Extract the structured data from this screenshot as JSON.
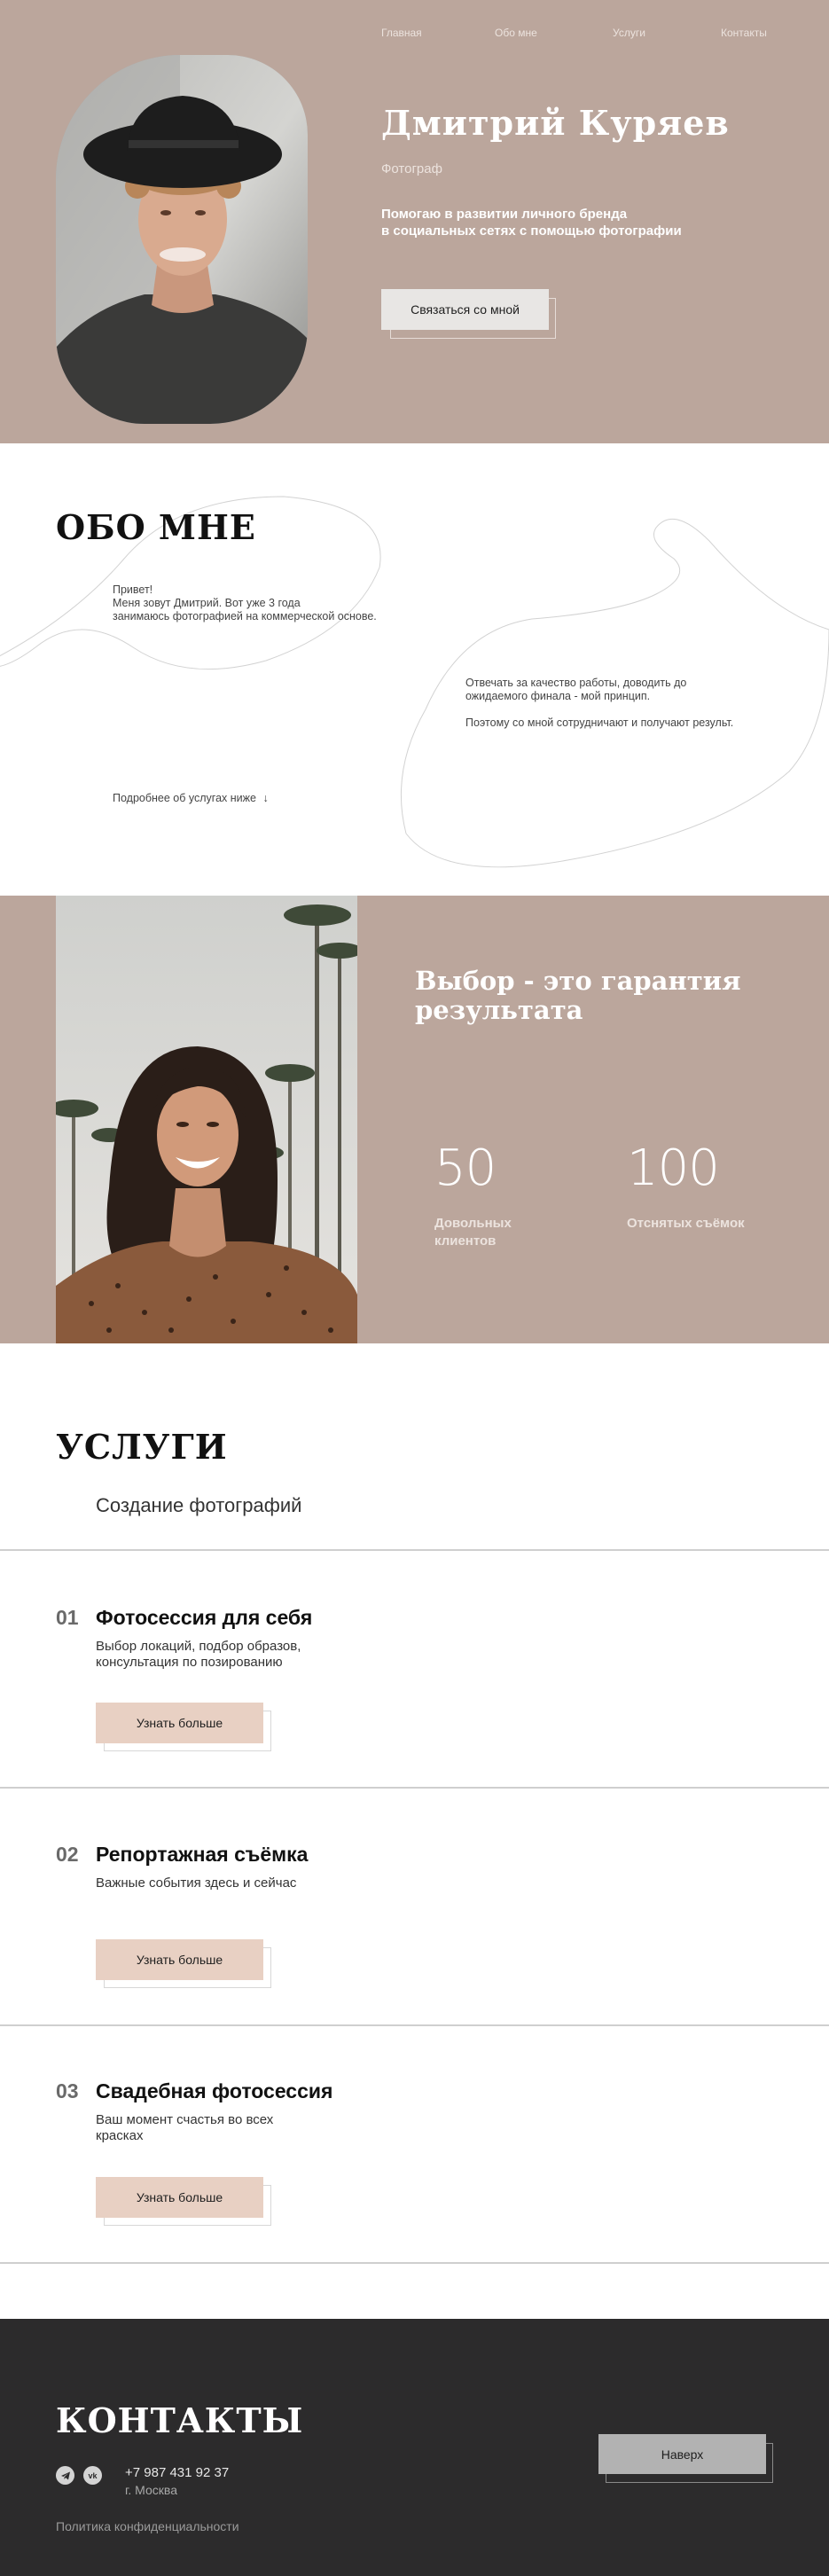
{
  "nav": {
    "items": [
      "Главная",
      "Обо мне",
      "Услуги",
      "Контакты"
    ]
  },
  "hero": {
    "name": "Дмитрий Куряев",
    "role": "Фотограф",
    "tagline_line1": "Помогаю в развитии личного бренда",
    "tagline_line2": "в социальных сетях с помощью фотографии",
    "cta_label": "Связаться со мной"
  },
  "about": {
    "title": "ОБО МНЕ",
    "intro_line1": "Привет!",
    "intro_line2": "Меня зовут Дмитрий. Вот уже 3 года",
    "intro_line3": "занимаюсь фотографией на коммерческой основе.",
    "quality_line1": "Отвечать за качество работы, доводить до",
    "quality_line2": "ожидаемого финала - мой принцип.",
    "trust": "Поэтому со мной сотрудничают и получают результ.",
    "more": "Подробнее об услугах ниже",
    "more_arrow": "↓"
  },
  "choice": {
    "title_line1": "Выбор - это гарантия",
    "title_line2": "результата",
    "stats": [
      {
        "value": "50",
        "label_line1": "Довольных",
        "label_line2": "клиентов"
      },
      {
        "value": "100",
        "label_line1": "Отснятых съёмок",
        "label_line2": ""
      }
    ]
  },
  "services": {
    "title": "УСЛУГИ",
    "subtitle": "Создание фотографий",
    "items": [
      {
        "num": "01",
        "title": "Фотосессия для себя",
        "desc_line1": "Выбор локаций, подбор образов,",
        "desc_line2": "консультация по позированию",
        "button": "Узнать больше"
      },
      {
        "num": "02",
        "title": "Репортажная съёмка",
        "desc_line1": "Важные события здесь и сейчас",
        "desc_line2": "",
        "button": "Узнать больше"
      },
      {
        "num": "03",
        "title": "Свадебная фотосессия",
        "desc_line1": "Ваш момент счастья во всех",
        "desc_line2": "красках",
        "button": "Узнать больше"
      }
    ]
  },
  "footer": {
    "title": "КОНТАКТЫ",
    "social": {
      "telegram_icon": "telegram-icon",
      "vk_icon": "vk-icon",
      "vk_text": "vk"
    },
    "phone": "+7 987 431 92 37",
    "city": "г. Москва",
    "privacy": "Политика конфиденциальности",
    "top_button": "Наверх"
  },
  "colors": {
    "accent": "#bba69c",
    "button_light": "#e8e6e4",
    "button_peach": "#e8d0c3",
    "button_gray": "#b2b2b2",
    "footer_bg": "#2c2b2c"
  }
}
